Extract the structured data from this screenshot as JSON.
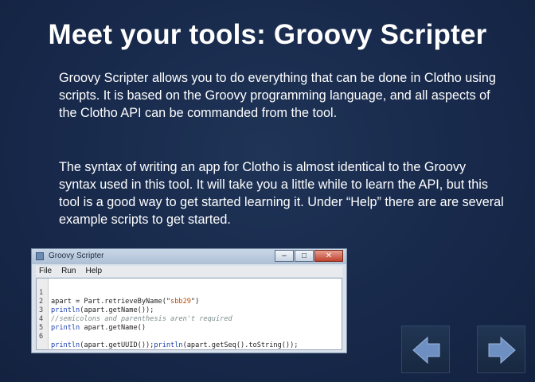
{
  "slide": {
    "title": "Meet your tools:  Groovy Scripter",
    "paragraphs": [
      "Groovy Scripter allows you to do everything that can be done in Clotho using scripts.  It is based on the Groovy programming language, and all aspects of the Clotho API can be commanded from the tool.",
      "The syntax of writing an app for Clotho is almost identical to the Groovy syntax used in this tool. It will take you a little while to learn the API, but this tool is a good way to get started learning it.  Under “Help” there are are several example scripts to get started."
    ]
  },
  "window": {
    "title": "Groovy Scripter",
    "controls": {
      "minimize": "–",
      "maximize": "□",
      "close": "✕"
    },
    "menu": [
      "File",
      "Run",
      "Help"
    ],
    "code_lines": [
      {
        "n": "1",
        "text": "apart = Part.retrieveByName(\"sbb29\")"
      },
      {
        "n": "2",
        "text": "println(apart.getName());"
      },
      {
        "n": "3",
        "text": "//semicolons and parenthesis aren't required"
      },
      {
        "n": "4",
        "text": "println apart.getName()"
      },
      {
        "n": "5",
        "text": ""
      },
      {
        "n": "6",
        "text": "println(apart.getUUID());println(apart.getSeq().toString());"
      }
    ]
  },
  "nav": {
    "prev_icon": "left-arrow-icon",
    "next_icon": "right-arrow-icon"
  },
  "colors": {
    "background": "#1a2c4d",
    "arrow": "#6e8fc2",
    "keyword": "#1b3fb0",
    "string": "#b34a00",
    "comment": "#7a8a8a"
  }
}
